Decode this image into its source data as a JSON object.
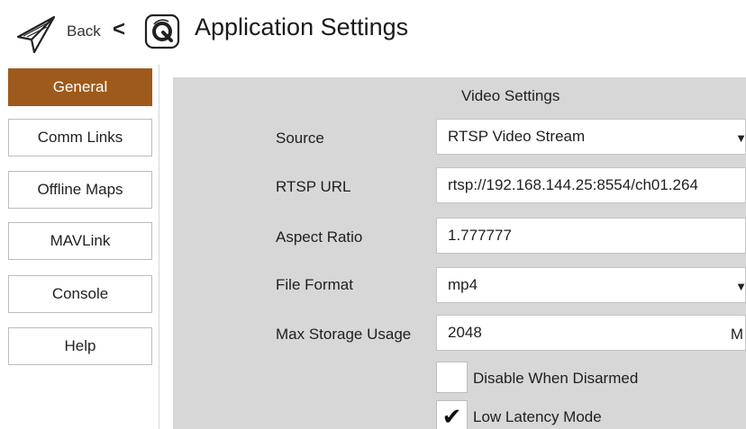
{
  "header": {
    "back_label": "Back",
    "back_chevron": "<",
    "title": "Application Settings",
    "icons": {
      "plane": "paper-plane-icon",
      "logo": "qgc-logo-icon"
    }
  },
  "sidebar": {
    "items": [
      {
        "label": "General",
        "active": true
      },
      {
        "label": "Comm Links",
        "active": false
      },
      {
        "label": "Offline Maps",
        "active": false
      },
      {
        "label": "MAVLink",
        "active": false
      },
      {
        "label": "Console",
        "active": false
      },
      {
        "label": "Help",
        "active": false
      }
    ]
  },
  "video_settings": {
    "title": "Video Settings",
    "source": {
      "label": "Source",
      "value": "RTSP Video Stream"
    },
    "rtsp_url": {
      "label": "RTSP URL",
      "value": "rtsp://192.168.144.25:8554/ch01.264"
    },
    "aspect_ratio": {
      "label": "Aspect Ratio",
      "value": "1.777777"
    },
    "file_format": {
      "label": "File Format",
      "value": "mp4"
    },
    "max_storage": {
      "label": "Max Storage Usage",
      "value": "2048",
      "unit": "M"
    },
    "disable_when_disarmed": {
      "label": "Disable When Disarmed",
      "checked": false
    },
    "low_latency_mode": {
      "label": "Low Latency Mode",
      "checked": true
    }
  },
  "colors": {
    "accent": "#9e5a1c",
    "panel_bg": "#d7d7d7",
    "field_bg": "#ffffff"
  }
}
